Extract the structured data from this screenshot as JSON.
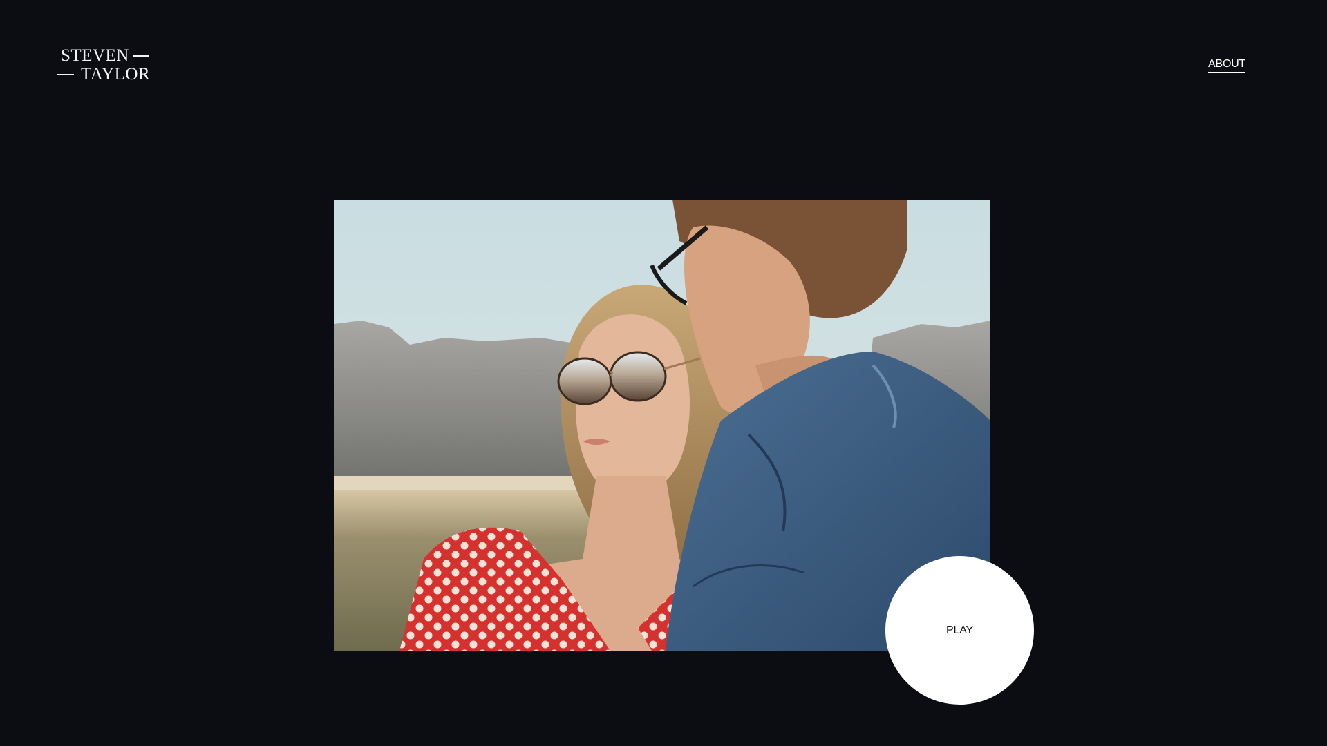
{
  "logo": {
    "line1": "STEVEN",
    "line2": "TAYLOR"
  },
  "nav": {
    "about_label": "ABOUT"
  },
  "hero": {
    "image_alt": "Couple wearing sunglasses in a desert landscape"
  },
  "play_button": {
    "label": "PLAY"
  },
  "colors": {
    "background": "#0b0d12",
    "text": "#ffffff",
    "play_button_bg": "#ffffff"
  }
}
